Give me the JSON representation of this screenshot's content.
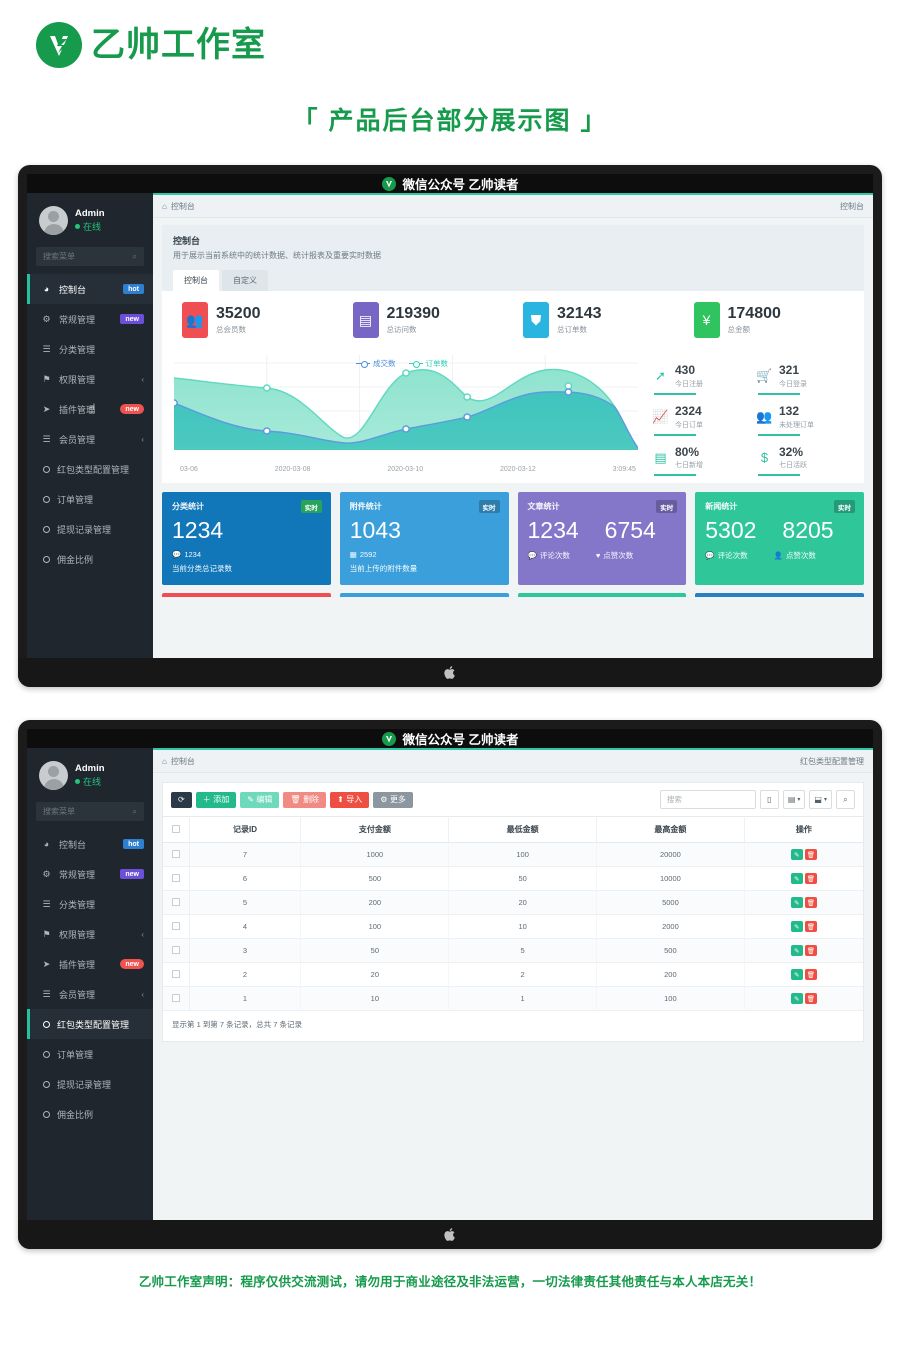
{
  "brand": {
    "name": "乙帅工作室",
    "logo_icon": "shield-v-logo"
  },
  "page_title": "「 产品后台部分展示图 」",
  "accent_colors": {
    "brand_green": "#169A4C",
    "sidebar_bg": "#1f262d",
    "teal_accent": "#2fc7a5",
    "red": "#ef4f43",
    "purple": "#8477c9",
    "blue": "#3b9fdb"
  },
  "titlebar": {
    "text": "微信公众号  乙帅读者",
    "logo_icon": "wechat-account-logo"
  },
  "sidebar": {
    "user": {
      "name": "Admin",
      "status": "在线"
    },
    "search_placeholder": "搜索菜单",
    "search_icon": "search-icon",
    "items": [
      {
        "label": "控制台",
        "icon": "dashboard-icon",
        "badge": "hot",
        "badge_type": "hot"
      },
      {
        "label": "常规管理",
        "icon": "cogs-icon",
        "badge": "new",
        "badge_type": "new-p"
      },
      {
        "label": "分类管理",
        "icon": "list-icon",
        "badge": "",
        "badge_type": ""
      },
      {
        "label": "权限管理",
        "icon": "users-cog-icon",
        "badge": "",
        "badge_type": "",
        "caret": "‹"
      },
      {
        "label": "插件管理",
        "icon": "plug-icon",
        "badge": "new",
        "badge_type": "new-r"
      },
      {
        "label": "会员管理",
        "icon": "list-icon",
        "badge": "",
        "badge_type": "",
        "caret": "‹"
      },
      {
        "label": "红包类型配置管理",
        "icon": "circle-icon",
        "badge": "",
        "badge_type": ""
      },
      {
        "label": "订单管理",
        "icon": "circle-icon",
        "badge": "",
        "badge_type": ""
      },
      {
        "label": "提现记录管理",
        "icon": "circle-icon",
        "badge": "",
        "badge_type": ""
      },
      {
        "label": "佣金比例",
        "icon": "circle-icon",
        "badge": "",
        "badge_type": ""
      }
    ],
    "active_index_screen1": 0,
    "active_index_screen2": 6
  },
  "screen1": {
    "breadcrumb_left": "控制台",
    "breadcrumb_left_icon": "home-icon",
    "breadcrumb_right": "控制台",
    "panel": {
      "heading": "控制台",
      "description": "用于展示当前系统中的统计数据、统计报表及重要实时数据",
      "tabs": [
        {
          "label": "控制台",
          "active": true
        },
        {
          "label": "自定义",
          "active": false
        }
      ]
    },
    "stats": [
      {
        "value": "35200",
        "label": "总会员数",
        "color": "#ef4f52",
        "icon": "users-icon"
      },
      {
        "value": "219390",
        "label": "总访问数",
        "color": "#7866c4",
        "icon": "book-icon"
      },
      {
        "value": "32143",
        "label": "总订单数",
        "color": "#2ab5e0",
        "icon": "bag-icon"
      },
      {
        "value": "174800",
        "label": "总金额",
        "color": "#2fc45f",
        "icon": "yen-icon"
      }
    ],
    "mini_stats": [
      {
        "value": "430",
        "label": "今日注册",
        "icon": "rocket-icon"
      },
      {
        "value": "321",
        "label": "今日登录",
        "icon": "cart-icon"
      },
      {
        "value": "2324",
        "label": "今日订单",
        "icon": "chart-line-icon"
      },
      {
        "value": "132",
        "label": "未处理订单",
        "icon": "users-icon"
      },
      {
        "value": "80%",
        "label": "七日新增",
        "icon": "list-alt-icon"
      },
      {
        "value": "32%",
        "label": "七日活跃",
        "icon": "dollar-icon"
      }
    ],
    "color_cards": [
      {
        "heading": "分类统计",
        "tag": "实时",
        "tag_green": true,
        "color_class": "c-teal",
        "nums": [
          "1234"
        ],
        "subs": [
          {
            "icon": "comment-icon",
            "text": "1234"
          }
        ],
        "foot": "当前分类总记录数"
      },
      {
        "heading": "附件统计",
        "tag": "实时",
        "tag_green": false,
        "color_class": "c-blue",
        "nums": [
          "1043"
        ],
        "subs": [
          {
            "icon": "image-icon",
            "text": "2592"
          }
        ],
        "foot": "当前上传的附件数量"
      },
      {
        "heading": "文章统计",
        "tag": "实时",
        "tag_green": false,
        "color_class": "c-purple",
        "nums": [
          "1234",
          "6754"
        ],
        "subs": [
          {
            "icon": "comment-icon",
            "text": "评论次数"
          },
          {
            "icon": "heart-icon",
            "text": "点赞次数"
          }
        ],
        "foot": ""
      },
      {
        "heading": "新闻统计",
        "tag": "实时",
        "tag_green": false,
        "color_class": "c-green",
        "nums": [
          "5302",
          "8205"
        ],
        "subs": [
          {
            "icon": "comment-icon",
            "text": "评论次数"
          },
          {
            "icon": "user-icon",
            "text": "点赞次数"
          }
        ],
        "foot": ""
      }
    ]
  },
  "chart_data": {
    "type": "area",
    "title": "",
    "legend": [
      "成交数",
      "订单数"
    ],
    "legend_position": "top-center",
    "xlabel": "",
    "ylabel": "",
    "x_tick_labels": [
      "03-06",
      "2020-03-08",
      "2020-03-10",
      "2020-03-12",
      "3:09:45"
    ],
    "grid": true,
    "ylim": [
      0,
      100
    ],
    "series": [
      {
        "name": "成交数",
        "color": "#4e8ee0",
        "fill": "#3fc4bd",
        "x": [
          0,
          1,
          2,
          3,
          4,
          5,
          6,
          7,
          8,
          9,
          10
        ],
        "values": [
          50,
          33,
          26,
          35,
          18,
          15,
          32,
          24,
          30,
          50,
          64
        ]
      },
      {
        "name": "订单数",
        "color": "#35d0b5",
        "fill": "#8ee3cf",
        "x": [
          0,
          1,
          2,
          3,
          4,
          5,
          6,
          7,
          8,
          9,
          10
        ],
        "values": [
          76,
          70,
          66,
          62,
          28,
          16,
          85,
          70,
          55,
          52,
          72
        ]
      }
    ]
  },
  "screen2": {
    "breadcrumb_left": "控制台",
    "breadcrumb_left_icon": "home-icon",
    "breadcrumb_right": "红包类型配置管理",
    "toolbar": {
      "buttons": [
        {
          "label": "",
          "icon": "refresh-icon",
          "style": "b-dark"
        },
        {
          "label": "添加",
          "icon": "plus-icon",
          "style": "b-green"
        },
        {
          "label": "编辑",
          "icon": "pencil-icon",
          "style": "b-mint"
        },
        {
          "label": "删除",
          "icon": "trash-icon",
          "style": "b-salmon"
        },
        {
          "label": "导入",
          "icon": "upload-icon",
          "style": "b-red"
        },
        {
          "label": "更多",
          "icon": "gear-icon",
          "style": "b-gray"
        }
      ],
      "search_placeholder": "搜索",
      "right_icons": [
        "copy-icon",
        "columns-icon",
        "export-icon",
        "search-icon"
      ]
    },
    "table": {
      "columns": [
        "",
        "记录ID",
        "支付金额",
        "最低金额",
        "最高金额",
        "操作"
      ],
      "rows": [
        {
          "id": "7",
          "pay": "1000",
          "min": "100",
          "max": "20000"
        },
        {
          "id": "6",
          "pay": "500",
          "min": "50",
          "max": "10000"
        },
        {
          "id": "5",
          "pay": "200",
          "min": "20",
          "max": "5000"
        },
        {
          "id": "4",
          "pay": "100",
          "min": "10",
          "max": "2000"
        },
        {
          "id": "3",
          "pay": "50",
          "min": "5",
          "max": "500"
        },
        {
          "id": "2",
          "pay": "20",
          "min": "2",
          "max": "200"
        },
        {
          "id": "1",
          "pay": "10",
          "min": "1",
          "max": "100"
        }
      ],
      "row_actions": [
        {
          "icon": "pencil-icon",
          "style": "op-edit"
        },
        {
          "icon": "trash-icon",
          "style": "op-del"
        }
      ],
      "footer": "显示第 1 到第 7 条记录，总共 7 条记录"
    }
  },
  "notice": "乙帅工作室声明：程序仅供交流测试，请勿用于商业途径及非法运营，一切法律责任其他责任与本人本店无关！"
}
